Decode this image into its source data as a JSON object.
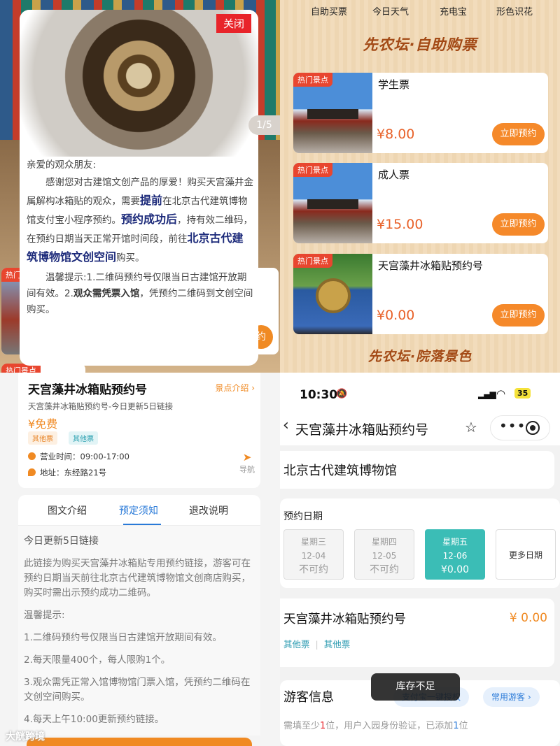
{
  "popup": {
    "close_label": "关闭",
    "pager": "1/5",
    "greeting": "亲爱的观众朋友:",
    "para1_a": "感谢您对古建馆文创产品的厚爱！购买天宫藻井金属解构冰箱贴的观众，需要",
    "para1_hl1": "提前",
    "para1_b": "在北京古代建筑博物馆支付宝小程序预约。",
    "para1_hl2": "预约成功后",
    "para1_c": "，持有效二维码，在预约日期当天正常开馆时间段，前往",
    "para1_hl3": "北京古代建筑博物馆文创空间",
    "para1_d": "购买。",
    "para2_a": "温馨提示:1.二维码预约号仅限当日古建馆开放期间有效。2.",
    "para2_bold": "观众需凭票入馆",
    "para2_b": "，凭预约二维码到文创空间购买。"
  },
  "bg_left": {
    "hot_tag1": "热门",
    "hot_tag2": "热门景点",
    "btn_stub": "约"
  },
  "ticket_page": {
    "nav": [
      "自助买票",
      "今日天气",
      "充电宝",
      "形色识花"
    ],
    "title": "先农坛·自助购票",
    "footer_title": "先农坛·院落景色",
    "tickets": [
      {
        "tag": "热门景点",
        "name": "学生票",
        "price": "¥8.00",
        "button": "立即预约"
      },
      {
        "tag": "热门景点",
        "name": "成人票",
        "price": "¥15.00",
        "button": "立即预约"
      },
      {
        "tag": "热门景点",
        "name": "天宫藻井冰箱贴预约号",
        "price": "¥0.00",
        "button": "立即预约"
      }
    ]
  },
  "detail": {
    "name": "天宫藻井冰箱贴预约号",
    "intro_link": "景点介绍 ›",
    "subtitle": "天宫藻井冰箱贴预约号-今日更新5日链接",
    "price": "¥免费",
    "tags": [
      "其他票",
      "其他票"
    ],
    "hours": "营业时间：09:00-17:00",
    "address": "地址：东经路21号",
    "nav_label": "导航",
    "tabs": [
      "图文介绍",
      "预定须知",
      "退改说明"
    ],
    "body": [
      "今日更新5日链接",
      "此链接为购买天宫藻井冰箱贴专用预约链接，游客可在预约日期当天前往北京古代建筑博物馆文创商店购买，购买时需出示预约成功二维码。",
      "温馨提示:",
      "1.二维码预约号仅限当日古建馆开放期间有效。",
      "2.每天限量400个，每人限购1个。",
      "3.观众需凭正常入馆博物馆门票入馆，凭预约二维码在文创空间购买。",
      "4.每天上午10:00更新预约链接。"
    ],
    "watermark": "大觥跨境"
  },
  "booking": {
    "time": "10:30",
    "battery": "35",
    "title": "天宫藻井冰箱贴预约号",
    "museum": "北京古代建筑博物馆",
    "date_label": "预约日期",
    "dates": [
      {
        "week": "星期三",
        "date": "12-04",
        "status": "不可约"
      },
      {
        "week": "星期四",
        "date": "12-05",
        "status": "不可约"
      },
      {
        "week": "星期五",
        "date": "12-06",
        "status": "¥0.00"
      }
    ],
    "more_dates": "更多日期",
    "product_name": "天宫藻井冰箱贴预约号",
    "product_price": "¥ 0.00",
    "product_tags": [
      "其他票",
      "其他票"
    ],
    "visitor_title": "游客信息",
    "auth_button": "支付宝一键授权",
    "common_visitor": "常用游客 ›",
    "note_a": "需填至少",
    "note_num": "1",
    "note_b": "位，用户入园身份验证，已添加",
    "note_num2": "1",
    "note_c": "位",
    "toast": "库存不足"
  }
}
